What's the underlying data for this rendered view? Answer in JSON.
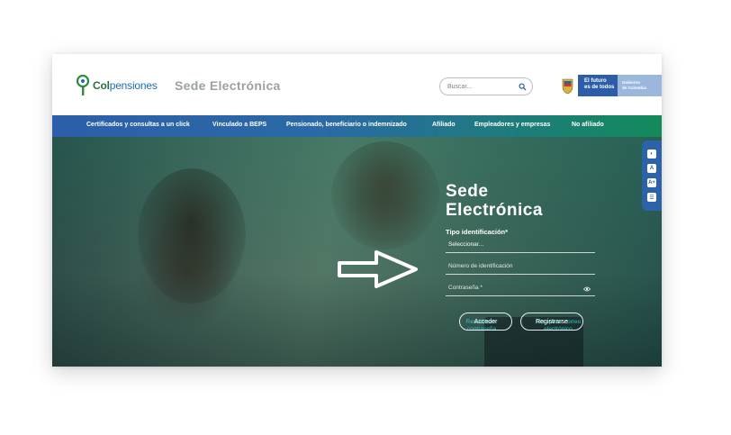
{
  "header": {
    "logo": {
      "col": "Col",
      "pensiones": "pensiones"
    },
    "site_title": "Sede Electrónica",
    "search_placeholder": "Buscar...",
    "gov": {
      "slogan_line1": "El futuro",
      "slogan_line2": "es de todos",
      "name_line1": "Gobierno",
      "name_line2": "de Colombia"
    }
  },
  "nav": {
    "items": [
      "Certificados y consultas a un click",
      "Vinculado a BEPS",
      "Pensionado, beneficiario o indemnizado",
      "Afiliado",
      "Empleadores y empresas",
      "No afiliado"
    ]
  },
  "login": {
    "title_line1": "Sede",
    "title_line2": "Electrónica",
    "id_type_label": "Tipo identificación*",
    "id_type_value": "Seleccionar...",
    "id_number_placeholder": "Número de identificación",
    "password_placeholder": "Contraseña *",
    "reset_password_line1": "Restablecer",
    "reset_password_line2": "contraseña",
    "recover_email_line1": "Recuperar correo",
    "recover_email_line2": "electrónico",
    "login_button": "Acceder",
    "register_button": "Registrarse"
  },
  "accessibility": {
    "buttons": [
      "contrast-icon",
      "text-size-icon",
      "text-size-large-icon",
      "sign-language-icon"
    ],
    "labels": [
      "◐",
      "A",
      "A+",
      "☰"
    ]
  },
  "colors": {
    "brand_blue": "#2c5ea9",
    "brand_green": "#138a5b",
    "link_cyan": "#33c5cf"
  }
}
